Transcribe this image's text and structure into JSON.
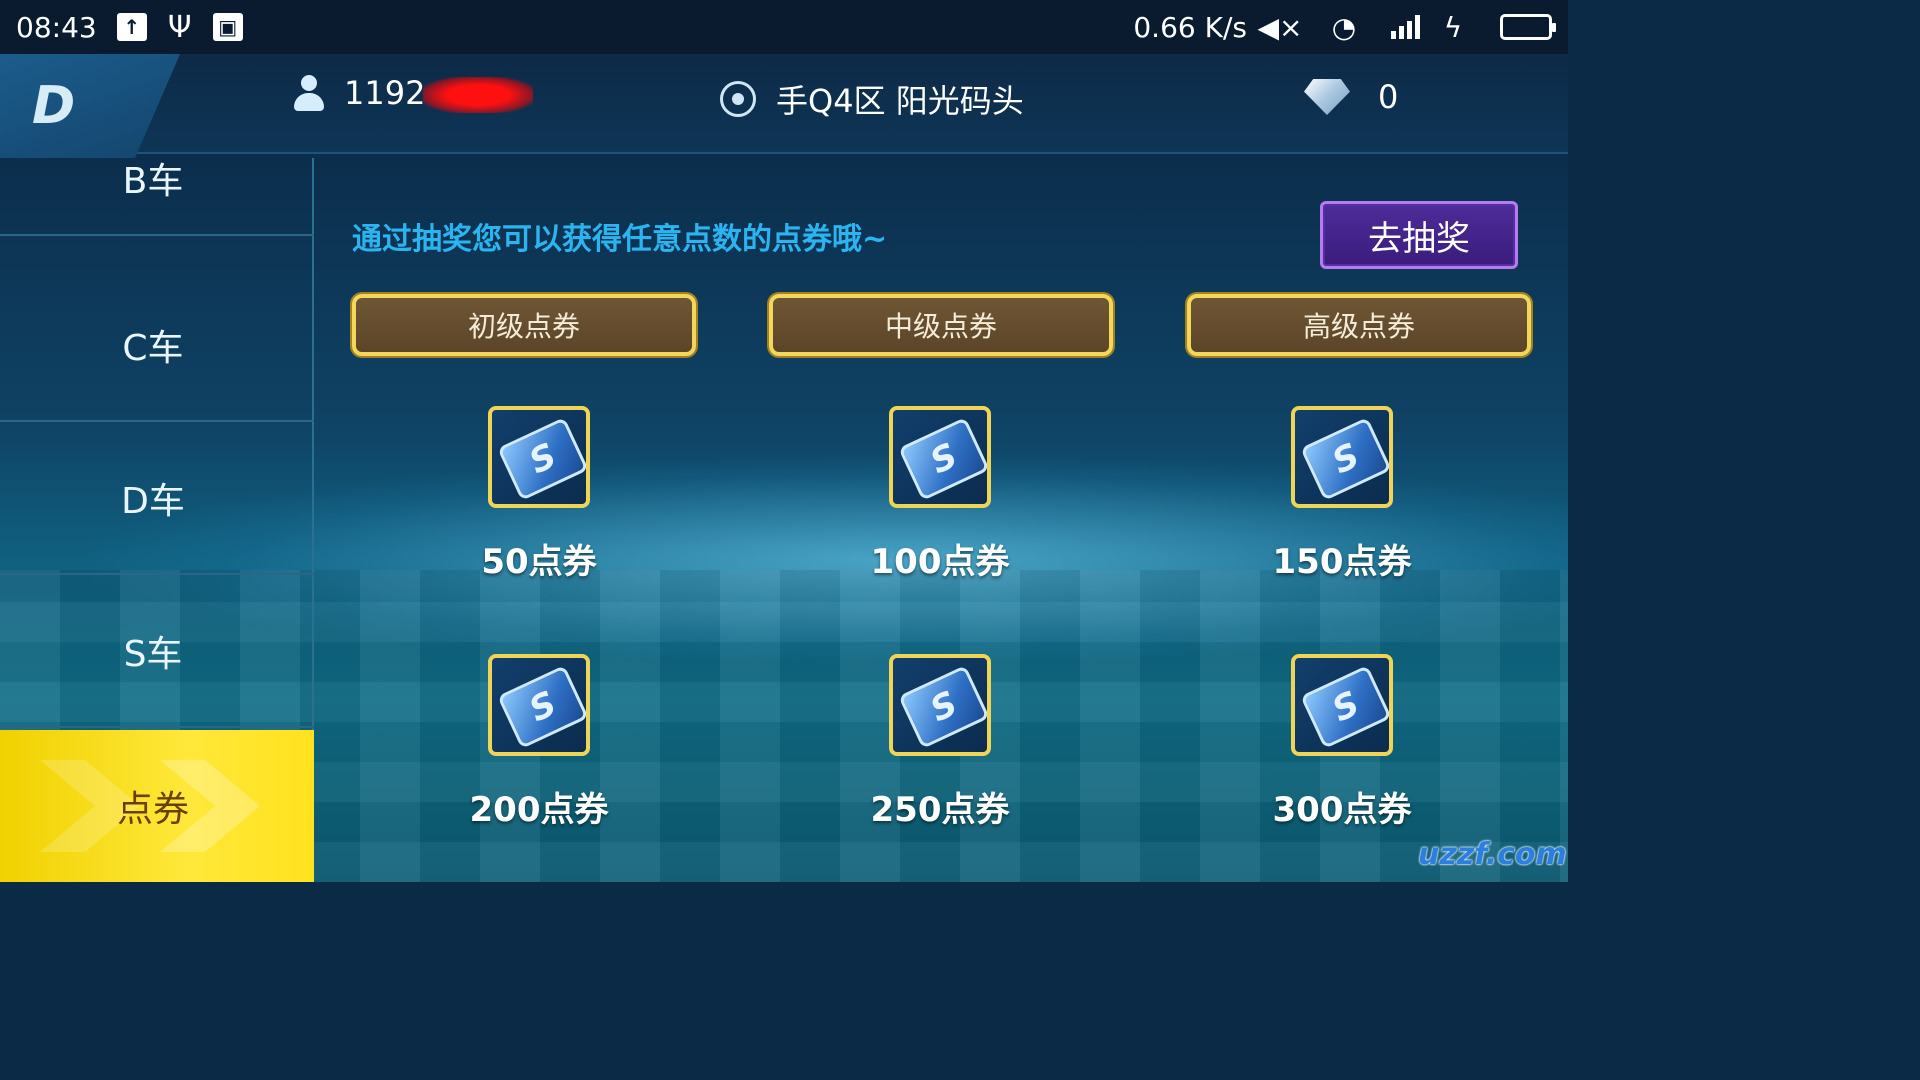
{
  "status_bar": {
    "time": "08:43",
    "left_icons": [
      "upload-icon",
      "usb-icon",
      "image-icon"
    ],
    "net_speed": "0.66 K/s",
    "right_icons": [
      "mute-icon",
      "wifi-icon",
      "signal-icon",
      "charging-icon",
      "battery-icon"
    ]
  },
  "header": {
    "back_logo": "D",
    "user_id_visible": "1192",
    "server": "手Q4区 阳光码头",
    "diamonds": "0"
  },
  "sidebar": {
    "items": [
      {
        "label": "B车",
        "active": false
      },
      {
        "label": "C车",
        "active": false
      },
      {
        "label": "D车",
        "active": false
      },
      {
        "label": "S车",
        "active": false
      },
      {
        "label": "点券",
        "active": true
      }
    ]
  },
  "main": {
    "hint": "通过抽奖您可以获得任意点数的点券哦~",
    "lottery_button": "去抽奖",
    "tiers": [
      "初级点券",
      "中级点券",
      "高级点券"
    ],
    "coupons": [
      {
        "label": "50点券"
      },
      {
        "label": "100点券"
      },
      {
        "label": "150点券"
      },
      {
        "label": "200点券"
      },
      {
        "label": "250点券"
      },
      {
        "label": "300点券"
      }
    ],
    "coupon_icon_glyph": "S"
  },
  "watermark": "uzzf.com",
  "colors": {
    "hint_text": "#2bb4ef",
    "tier_border": "#f2d75a",
    "active_tab": "#ffe21e",
    "lottery_button": "#3a1c7c"
  }
}
